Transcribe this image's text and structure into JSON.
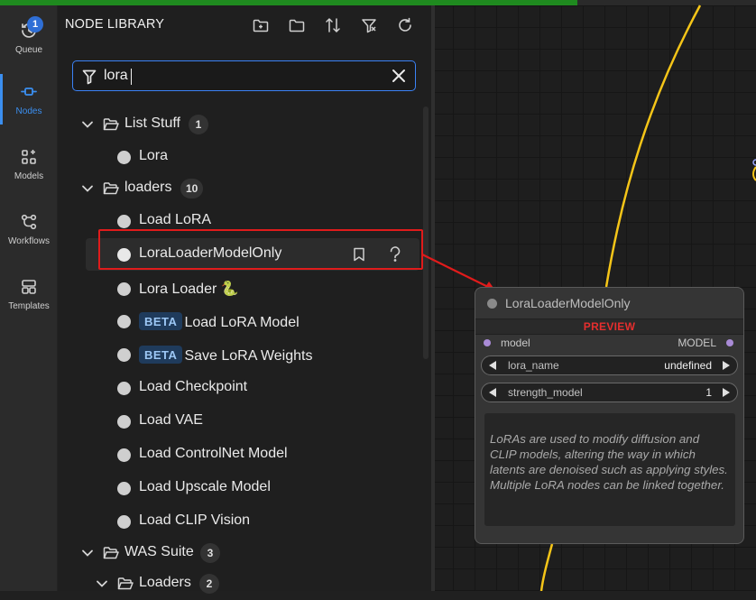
{
  "rail": {
    "items": [
      {
        "label": "Queue",
        "badge": "1"
      },
      {
        "label": "Nodes"
      },
      {
        "label": "Models"
      },
      {
        "label": "Workflows"
      },
      {
        "label": "Templates"
      }
    ],
    "active": "Nodes"
  },
  "panel": {
    "title": "NODE LIBRARY",
    "header_icons": [
      "new-folder-icon",
      "folder-icon",
      "sort-icon",
      "filter-icon",
      "refresh-icon"
    ]
  },
  "search": {
    "value": "lora",
    "icon": "filter-icon",
    "clear_icon": "close-icon"
  },
  "tree": {
    "list_stuff": {
      "label": "List Stuff",
      "count": "1"
    },
    "lora": {
      "label": "Lora"
    },
    "loaders": {
      "label": "loaders",
      "count": "10"
    },
    "load_lora": {
      "label": "Load LoRA"
    },
    "lora_loader_model_only": {
      "label": "LoraLoaderModelOnly"
    },
    "lora_loader": {
      "label": "Lora Loader 🐍"
    },
    "load_lora_model": {
      "label": "Load LoRA Model",
      "badge": "BETA"
    },
    "save_lora_weights": {
      "label": "Save LoRA Weights",
      "badge": "BETA"
    },
    "load_checkpoint": {
      "label": "Load Checkpoint"
    },
    "load_vae": {
      "label": "Load VAE"
    },
    "load_controlnet": {
      "label": "Load ControlNet Model"
    },
    "load_upscale": {
      "label": "Load Upscale Model"
    },
    "load_clip_vision": {
      "label": "Load CLIP Vision"
    },
    "was_suite": {
      "label": "WAS Suite",
      "count": "3"
    },
    "was_loaders": {
      "label": "Loaders",
      "count": "2"
    }
  },
  "preview_node": {
    "title": "LoraLoaderModelOnly",
    "preview_label": "PREVIEW",
    "input": "model",
    "output": "MODEL",
    "widgets": [
      {
        "name": "lora_name",
        "value": "undefined"
      },
      {
        "name": "strength_model",
        "value": "1"
      }
    ],
    "description": "LoRAs are used to modify diffusion and CLIP models, altering the way in which latents are denoised such as applying styles. Multiple LoRA nodes can be linked together."
  },
  "colors": {
    "accent": "#3b8ff0",
    "highlight": "#e01b1b",
    "preview": "#e62e2e",
    "link": "#f5c518",
    "slot": "#a98bd6"
  }
}
